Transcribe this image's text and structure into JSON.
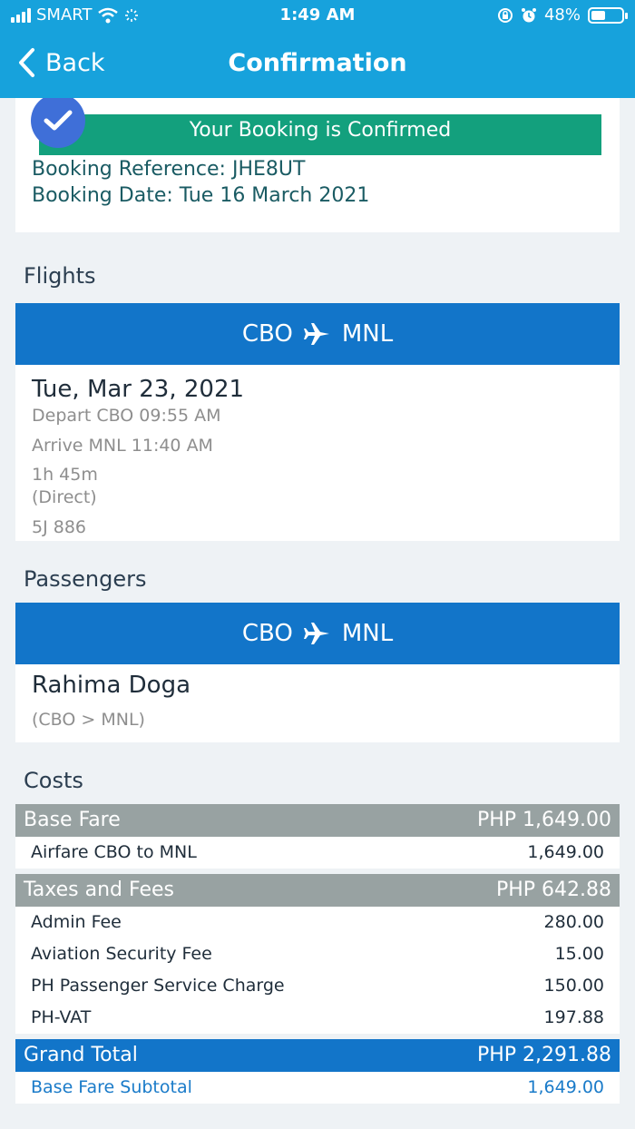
{
  "status_bar": {
    "carrier": "SMART",
    "time": "1:49 AM",
    "battery": "48%",
    "battery_level": 0.48
  },
  "nav": {
    "back_label": "Back",
    "title": "Confirmation"
  },
  "confirmation": {
    "banner": "Your Booking is Confirmed",
    "reference": "Booking Reference: JHE8UT",
    "date": "Booking Date: Tue 16 March 2021"
  },
  "flights": {
    "title": "Flights",
    "origin": "CBO",
    "destination": "MNL",
    "date": "Tue, Mar 23, 2021",
    "depart": "Depart  CBO  09:55 AM",
    "arrive": "Arrive  MNL  11:40 AM",
    "duration": "1h 45m",
    "stops": "(Direct)",
    "flight_number": "5J 886"
  },
  "passengers": {
    "title": "Passengers",
    "origin": "CBO",
    "destination": "MNL",
    "name": "Rahima Doga",
    "route": "(CBO > MNL)"
  },
  "costs": {
    "title": "Costs",
    "base_fare": {
      "label": "Base Fare",
      "amount": "PHP 1,649.00"
    },
    "airfare": {
      "label": "Airfare CBO to MNL",
      "amount": "1,649.00"
    },
    "taxes": {
      "label": "Taxes and Fees",
      "amount": "PHP 642.88"
    },
    "fees": [
      {
        "label": "Admin Fee",
        "amount": "280.00"
      },
      {
        "label": "Aviation Security Fee",
        "amount": "15.00"
      },
      {
        "label": "PH Passenger Service Charge",
        "amount": "150.00"
      },
      {
        "label": "PH-VAT",
        "amount": "197.88"
      }
    ],
    "grand_total": {
      "label": "Grand Total",
      "amount": "PHP 2,291.88"
    },
    "subtotal": {
      "label": "Base Fare Subtotal",
      "amount": "1,649.00"
    }
  },
  "colors": {
    "header": "#17a2dc",
    "route_bar": "#1275c9",
    "confirm_banner": "#13a07d",
    "cost_header": "#98a2a2",
    "background": "#eef2f5"
  },
  "icons": {
    "back": "chevron-left-icon",
    "plane": "airplane-icon",
    "check": "checkmark-icon",
    "wifi": "wifi-icon",
    "alarm": "alarm-icon",
    "lock_rotation": "rotation-lock-icon"
  }
}
